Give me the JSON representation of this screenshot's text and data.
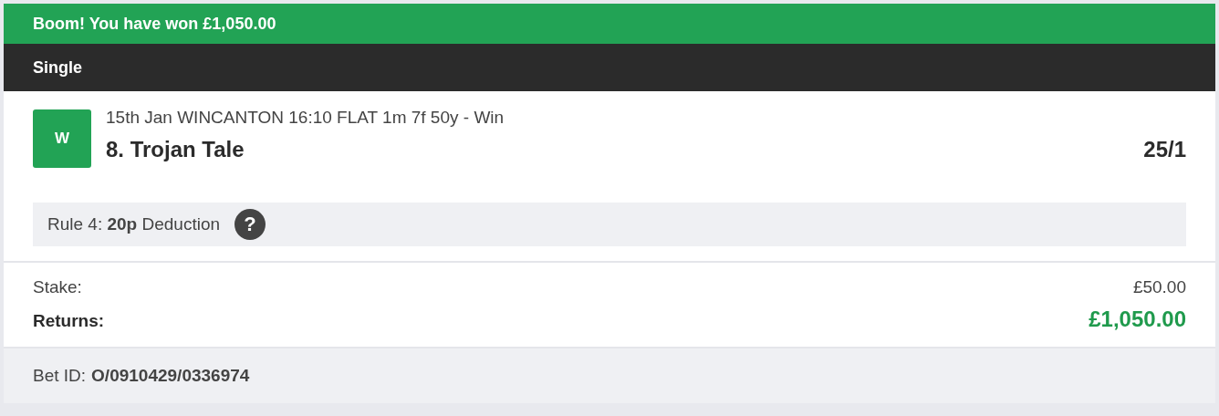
{
  "banner": {
    "text": "Boom! You have won £1,050.00"
  },
  "bet_type": "Single",
  "selection": {
    "result_badge": "W",
    "event": "15th Jan WINCANTON 16:10 FLAT 1m 7f 50y - Win",
    "runner": "8. Trojan Tale",
    "odds": "25/1"
  },
  "rule4": {
    "text": "Rule 4: **20p** Deduction",
    "help_glyph": "?"
  },
  "summary": [
    {
      "label": "Stake:",
      "value": "£50.00",
      "kind": "plain"
    },
    {
      "label": "Returns:",
      "value": "£1,050.00",
      "kind": "returns"
    }
  ],
  "bet_id": {
    "label": "Bet ID:",
    "value": "O/0910429/0336974"
  }
}
